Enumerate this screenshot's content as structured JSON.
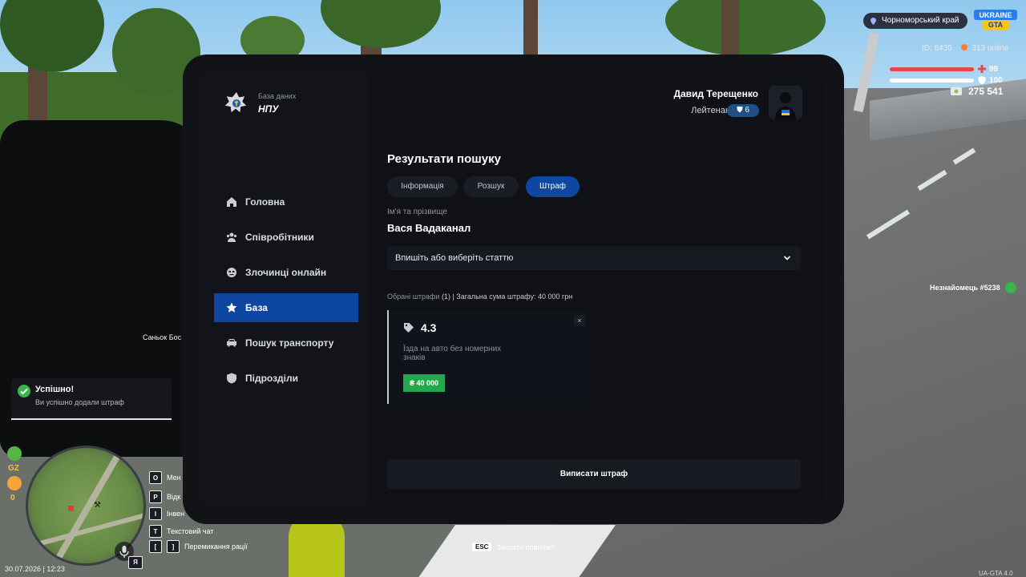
{
  "hud": {
    "region": "Чорноморський край",
    "player_id": "ID: 6430",
    "online": "313 online",
    "health": "99",
    "armor": "100",
    "money": "275 541",
    "stranger_tag": "Незнайомець #5238",
    "world_name": "Саньок Бос",
    "datetime": "30.07.2026 | 12:23",
    "gz_label": "GZ",
    "counter_label": "0",
    "mic_key": "Я",
    "version": "UA-GTA 4.0",
    "esc_key": "ESC",
    "esc_hint": "Закрити планшет",
    "logo_text": "UKRAINE GTA",
    "colors": {
      "health": "#e8474d",
      "armor": "#ffffff",
      "accent": "#0d47a1",
      "success": "#23a84d"
    }
  },
  "toast": {
    "title": "Успішно!",
    "message": "Ви успішно додали штраф"
  },
  "keybinds": [
    {
      "keys": [
        "O"
      ],
      "label": "Мен"
    },
    {
      "keys": [
        "P"
      ],
      "label": "Відк"
    },
    {
      "keys": [
        "I"
      ],
      "label": "Інвен"
    },
    {
      "keys": [
        "T"
      ],
      "label": "Текстовий чат"
    },
    {
      "keys": [
        "[",
        "]"
      ],
      "label": "Перемикання рації"
    }
  ],
  "tablet": {
    "brand": {
      "subtitle": "База даних",
      "title": "НПУ"
    },
    "user": {
      "name": "Давид Терещенко",
      "rank": "Лейтенант",
      "level": "6"
    },
    "nav": [
      {
        "label": "Головна",
        "icon": "home-icon"
      },
      {
        "label": "Співробітники",
        "icon": "people-icon"
      },
      {
        "label": "Злочинці онлайн",
        "icon": "criminal-icon"
      },
      {
        "label": "База",
        "icon": "star-icon",
        "active": true
      },
      {
        "label": "Пошук транспорту",
        "icon": "car-icon"
      },
      {
        "label": "Підрозділи",
        "icon": "shield-icon"
      }
    ],
    "results_title": "Результати пошуку",
    "tabs": [
      {
        "label": "Інформація"
      },
      {
        "label": "Розшук"
      },
      {
        "label": "Штраф",
        "active": true
      }
    ],
    "name_label": "Ім'я та прізвище",
    "person_name": "Вася Вадаканал",
    "article_select": "Впишіть або виберіть статтю",
    "summary_prefix": "Обрані штрафи",
    "summary_count": "(1)",
    "summary_rest": "| Загальна сума штрафу: 40 000 грн",
    "fines": [
      {
        "code": "4.3",
        "description": "Їзда на авто без номерних знаків",
        "amount": "₴ 40 000"
      }
    ],
    "close_label": "×",
    "submit_label": "Виписати штраф"
  }
}
